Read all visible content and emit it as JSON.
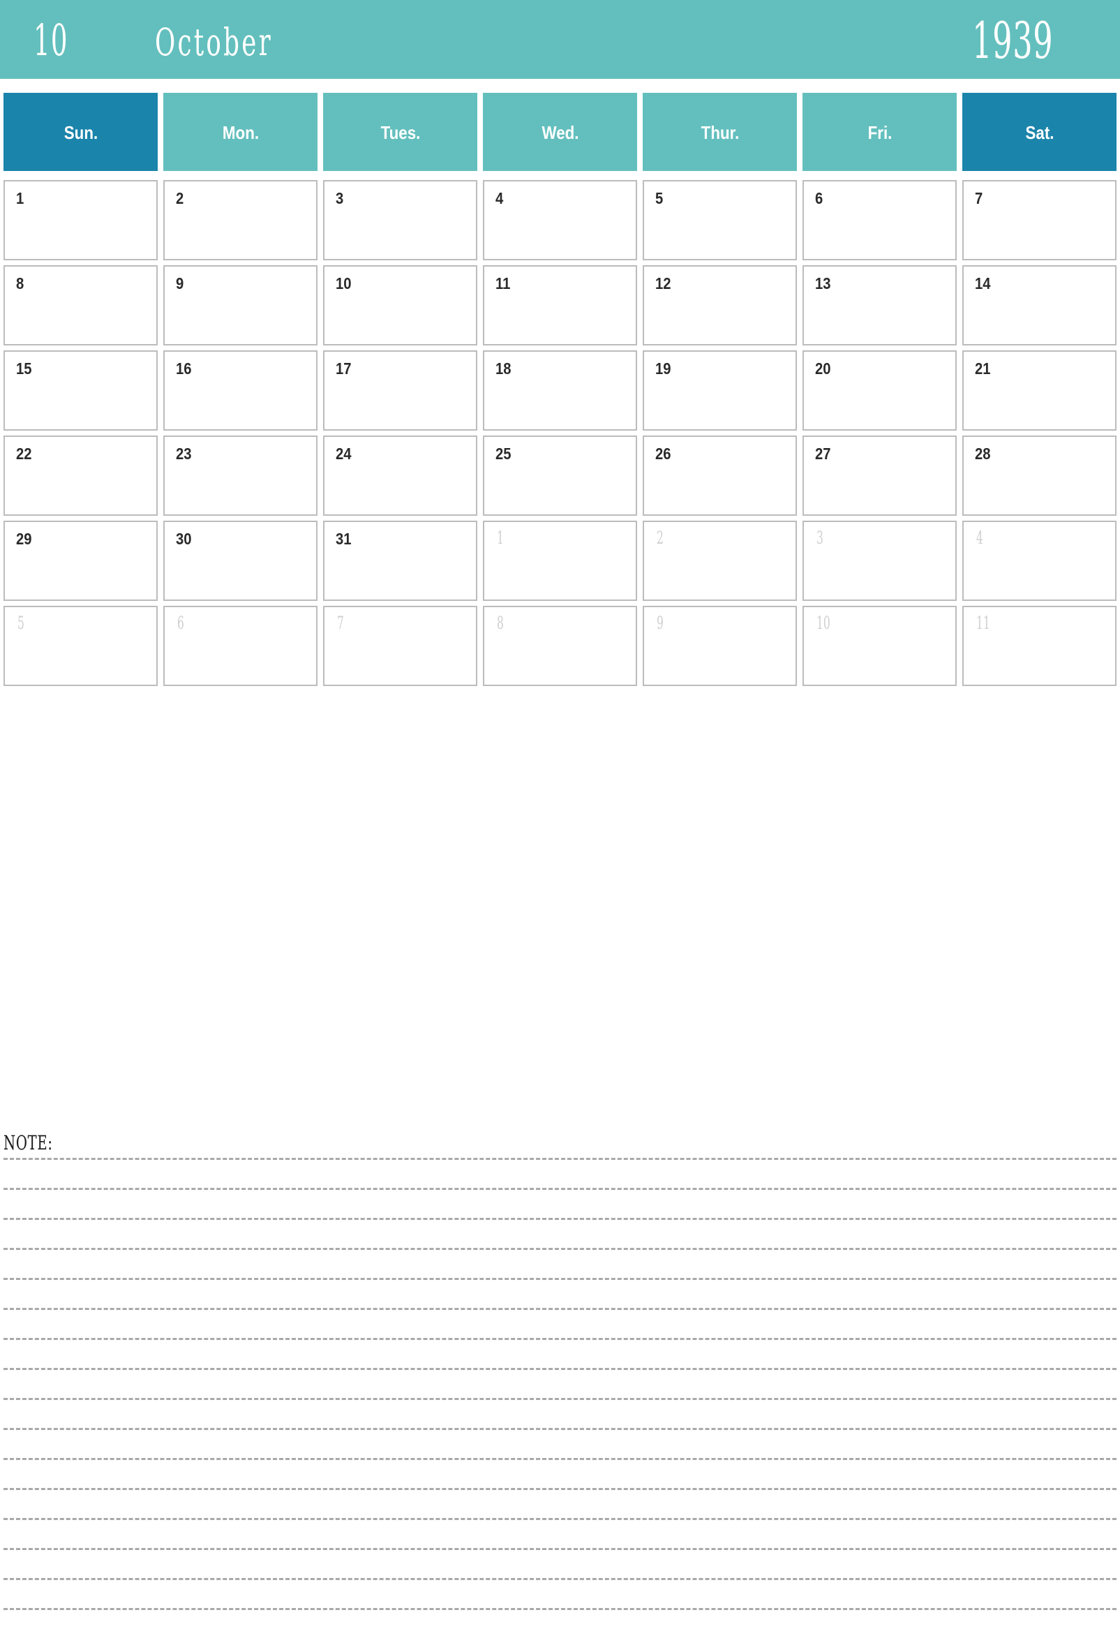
{
  "header": {
    "month_number": "10",
    "month_name": "October",
    "year": "1939",
    "band_color": "#63bfbd"
  },
  "weekdays": {
    "accent_color": "#63bfbd",
    "weekend_color": "#1b84ab",
    "items": [
      {
        "label": "Sun.",
        "weekend": true
      },
      {
        "label": "Mon.",
        "weekend": false
      },
      {
        "label": "Tues.",
        "weekend": false
      },
      {
        "label": "Wed.",
        "weekend": false
      },
      {
        "label": "Thur.",
        "weekend": false
      },
      {
        "label": "Fri.",
        "weekend": false
      },
      {
        "label": "Sat.",
        "weekend": true
      }
    ]
  },
  "weeks": [
    [
      {
        "day": "1",
        "adjacent": false
      },
      {
        "day": "2",
        "adjacent": false
      },
      {
        "day": "3",
        "adjacent": false
      },
      {
        "day": "4",
        "adjacent": false
      },
      {
        "day": "5",
        "adjacent": false
      },
      {
        "day": "6",
        "adjacent": false
      },
      {
        "day": "7",
        "adjacent": false
      }
    ],
    [
      {
        "day": "8",
        "adjacent": false
      },
      {
        "day": "9",
        "adjacent": false
      },
      {
        "day": "10",
        "adjacent": false
      },
      {
        "day": "11",
        "adjacent": false
      },
      {
        "day": "12",
        "adjacent": false
      },
      {
        "day": "13",
        "adjacent": false
      },
      {
        "day": "14",
        "adjacent": false
      }
    ],
    [
      {
        "day": "15",
        "adjacent": false
      },
      {
        "day": "16",
        "adjacent": false
      },
      {
        "day": "17",
        "adjacent": false
      },
      {
        "day": "18",
        "adjacent": false
      },
      {
        "day": "19",
        "adjacent": false
      },
      {
        "day": "20",
        "adjacent": false
      },
      {
        "day": "21",
        "adjacent": false
      }
    ],
    [
      {
        "day": "22",
        "adjacent": false
      },
      {
        "day": "23",
        "adjacent": false
      },
      {
        "day": "24",
        "adjacent": false
      },
      {
        "day": "25",
        "adjacent": false
      },
      {
        "day": "26",
        "adjacent": false
      },
      {
        "day": "27",
        "adjacent": false
      },
      {
        "day": "28",
        "adjacent": false
      }
    ],
    [
      {
        "day": "29",
        "adjacent": false
      },
      {
        "day": "30",
        "adjacent": false
      },
      {
        "day": "31",
        "adjacent": false
      },
      {
        "day": "1",
        "adjacent": true
      },
      {
        "day": "2",
        "adjacent": true
      },
      {
        "day": "3",
        "adjacent": true
      },
      {
        "day": "4",
        "adjacent": true
      }
    ],
    [
      {
        "day": "5",
        "adjacent": true
      },
      {
        "day": "6",
        "adjacent": true
      },
      {
        "day": "7",
        "adjacent": true
      },
      {
        "day": "8",
        "adjacent": true
      },
      {
        "day": "9",
        "adjacent": true
      },
      {
        "day": "10",
        "adjacent": true
      },
      {
        "day": "11",
        "adjacent": true
      }
    ]
  ],
  "note": {
    "label": "NOTE:",
    "line_count": 16,
    "line_color": "#a9a9a9"
  }
}
